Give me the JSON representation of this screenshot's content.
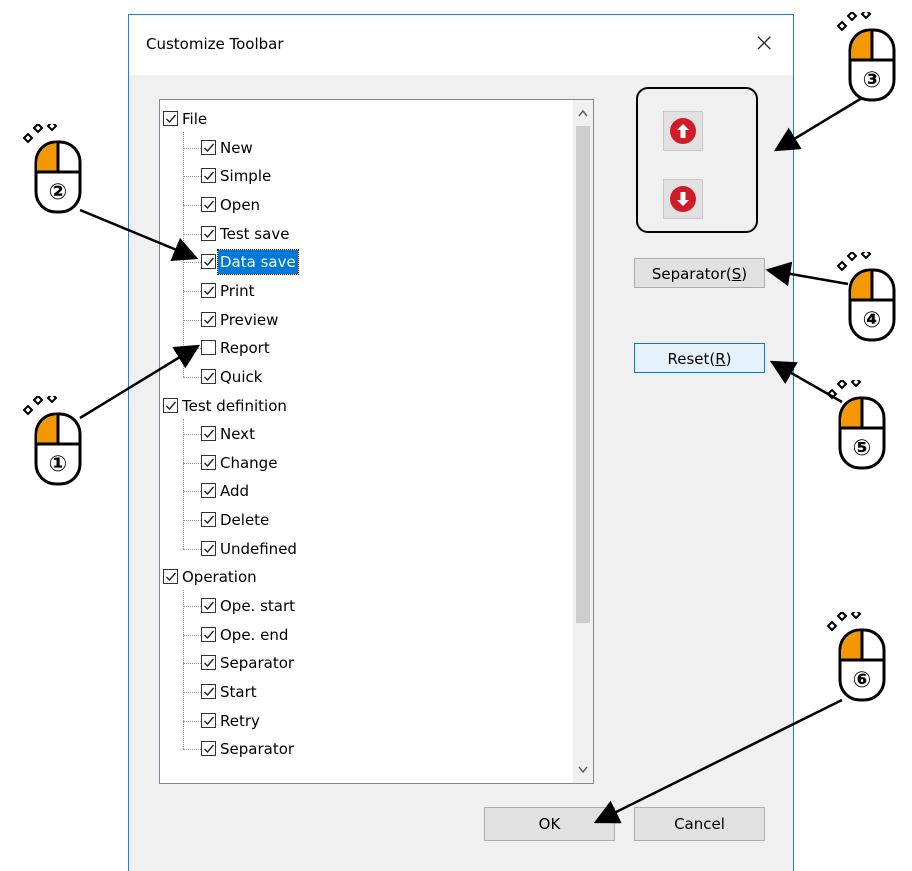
{
  "dialog": {
    "title": "Customize Toolbar",
    "close_glyph": "×"
  },
  "tree": {
    "groups": [
      {
        "label": "File",
        "checked": true,
        "items": [
          {
            "label": "New",
            "checked": true
          },
          {
            "label": "Simple",
            "checked": true
          },
          {
            "label": "Open",
            "checked": true
          },
          {
            "label": "Test save",
            "checked": true
          },
          {
            "label": "Data save",
            "checked": true,
            "selected": true
          },
          {
            "label": "Print",
            "checked": true
          },
          {
            "label": "Preview",
            "checked": true
          },
          {
            "label": "Report",
            "checked": false
          },
          {
            "label": "Quick",
            "checked": true
          }
        ]
      },
      {
        "label": "Test definition",
        "checked": true,
        "items": [
          {
            "label": "Next",
            "checked": true
          },
          {
            "label": "Change",
            "checked": true
          },
          {
            "label": "Add",
            "checked": true
          },
          {
            "label": "Delete",
            "checked": true
          },
          {
            "label": "Undefined",
            "checked": true
          }
        ]
      },
      {
        "label": "Operation",
        "checked": true,
        "items": [
          {
            "label": "Ope. start",
            "checked": true
          },
          {
            "label": "Ope. end",
            "checked": true
          },
          {
            "label": "Separator",
            "checked": true
          },
          {
            "label": "Start",
            "checked": true
          },
          {
            "label": "Retry",
            "checked": true
          },
          {
            "label": "Separator",
            "checked": true
          }
        ]
      }
    ],
    "scroll_up": "⌃",
    "scroll_down": "⌄"
  },
  "buttons": {
    "separator": {
      "text": "Separator(",
      "key": "S",
      "close": ")"
    },
    "reset": {
      "text": "Reset(",
      "key": "R",
      "close": ")"
    },
    "ok": "OK",
    "cancel": "Cancel"
  },
  "callouts": [
    "①",
    "②",
    "③",
    "④",
    "⑤",
    "⑥"
  ],
  "colors": {
    "accent": "#0078d7",
    "arrow_button_red": "#d01c27",
    "mouse_orange": "#f39800"
  }
}
